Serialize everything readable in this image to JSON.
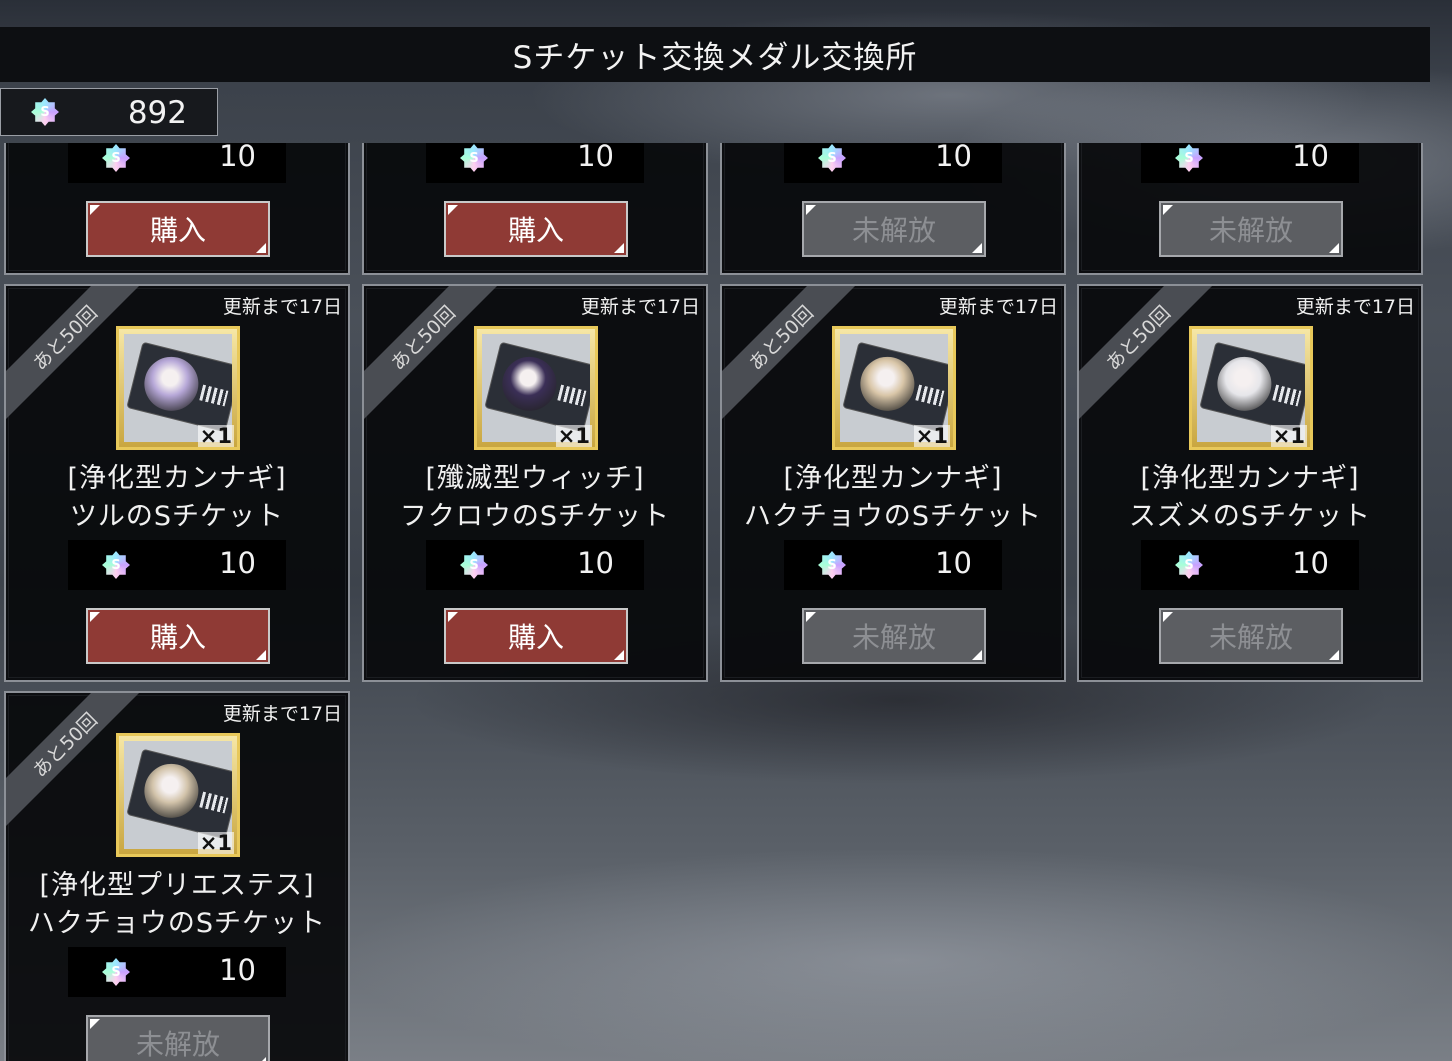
{
  "header": {
    "title": "Sチケット交換メダル交換所"
  },
  "wallet": {
    "icon": "s-medal-icon",
    "amount": "892"
  },
  "colors": {
    "buy_button": "#8f3a35",
    "locked_button": "#5c5e62",
    "frame_gold": "#e8c85a"
  },
  "cards": [
    {
      "ribbon": "",
      "refresh": "",
      "name_line1": "",
      "name_line2": "",
      "price": "10",
      "button": "購入",
      "state": "buy",
      "thumb": ""
    },
    {
      "ribbon": "",
      "refresh": "",
      "name_line1": "",
      "name_line2": "",
      "price": "10",
      "button": "購入",
      "state": "buy",
      "thumb": ""
    },
    {
      "ribbon": "",
      "refresh": "",
      "name_line1": "",
      "name_line2": "",
      "price": "10",
      "button": "未解放",
      "state": "locked",
      "thumb": ""
    },
    {
      "ribbon": "",
      "refresh": "",
      "name_line1": "",
      "name_line2": "",
      "price": "10",
      "button": "未解放",
      "state": "locked",
      "thumb": ""
    },
    {
      "ribbon": "あと50回",
      "refresh": "更新まで17日",
      "name_line1": "[浄化型カンナギ]",
      "name_line2": "ツルのSチケット",
      "price": "10",
      "button": "購入",
      "state": "buy",
      "qty": "×1",
      "thumb": "#b7a8d8"
    },
    {
      "ribbon": "あと50回",
      "refresh": "更新まで17日",
      "name_line1": "[殲滅型ウィッチ]",
      "name_line2": "フクロウのSチケット",
      "price": "10",
      "button": "購入",
      "state": "buy",
      "qty": "×1",
      "thumb": "#3b2f57"
    },
    {
      "ribbon": "あと50回",
      "refresh": "更新まで17日",
      "name_line1": "[浄化型カンナギ]",
      "name_line2": "ハクチョウのSチケット",
      "price": "10",
      "button": "未解放",
      "state": "locked",
      "qty": "×1",
      "thumb": "#d9c6a8"
    },
    {
      "ribbon": "あと50回",
      "refresh": "更新まで17日",
      "name_line1": "[浄化型カンナギ]",
      "name_line2": "スズメのSチケット",
      "price": "10",
      "button": "未解放",
      "state": "locked",
      "qty": "×1",
      "thumb": "#e6e6ea"
    },
    {
      "ribbon": "あと50回",
      "refresh": "更新まで17日",
      "name_line1": "[浄化型プリエステス]",
      "name_line2": "ハクチョウのSチケット",
      "price": "10",
      "button": "未解放",
      "state": "locked",
      "qty": "×1",
      "thumb": "#d2c3aa"
    }
  ]
}
